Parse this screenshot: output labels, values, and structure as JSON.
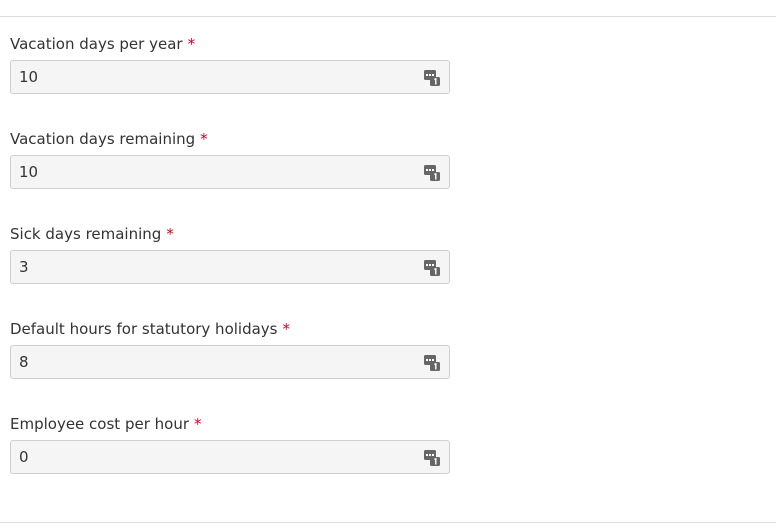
{
  "fields": [
    {
      "label": "Vacation days per year",
      "required_mark": "*",
      "value": "10"
    },
    {
      "label": "Vacation days remaining",
      "required_mark": "*",
      "value": "10"
    },
    {
      "label": "Sick days remaining",
      "required_mark": "*",
      "value": "3"
    },
    {
      "label": "Default hours for statutory holidays",
      "required_mark": "*",
      "value": "8"
    },
    {
      "label": "Employee cost per hour",
      "required_mark": "*",
      "value": "0"
    }
  ],
  "icons": {
    "field_icon": "numeric-keypad-icon"
  },
  "colors": {
    "required": "#d0021b",
    "input_background": "#f5f5f5",
    "input_border": "#cfcfcf",
    "text": "#333333",
    "icon": "#666666"
  }
}
